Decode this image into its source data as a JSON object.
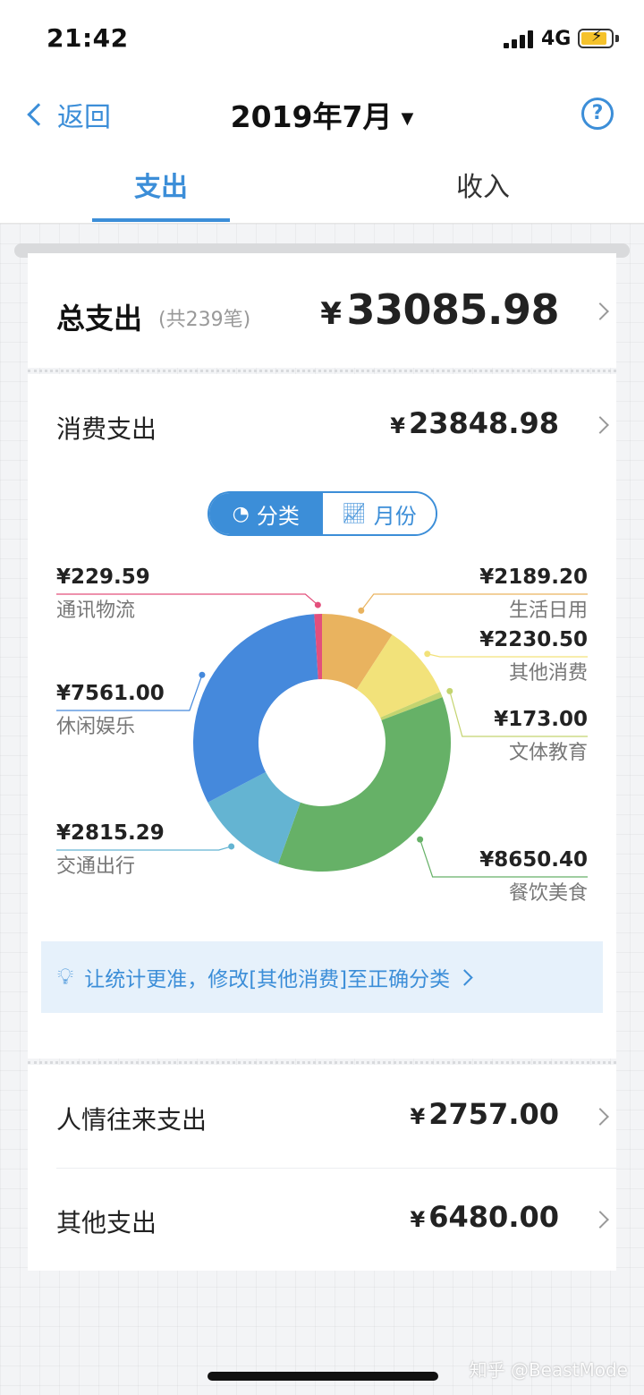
{
  "status_bar": {
    "time": "21:42",
    "network": "4G"
  },
  "nav": {
    "back_label": "返回",
    "title": "2019年7月",
    "title_caret": "▼",
    "help_label": "?"
  },
  "tabs": [
    {
      "label": "支出",
      "active": true
    },
    {
      "label": "收入",
      "active": false
    }
  ],
  "total": {
    "label": "总支出",
    "count": "(共239笔)",
    "currency": "¥",
    "amount": "33085.98"
  },
  "consume": {
    "label": "消费支出",
    "currency": "¥",
    "amount": "23848.98",
    "toggle": {
      "category": "分类",
      "month": "月份"
    }
  },
  "chart_data": {
    "type": "pie",
    "donut": true,
    "categories": [
      "生活日用",
      "其他消费",
      "文体教育",
      "餐饮美食",
      "交通出行",
      "休闲娱乐",
      "通讯物流"
    ],
    "values": [
      2189.2,
      2230.5,
      173.0,
      8650.4,
      2815.29,
      7561.0,
      229.59
    ],
    "colors": [
      "#e9b35f",
      "#f2e27a",
      "#c4d46f",
      "#66b167",
      "#64b4d2",
      "#4589dc",
      "#e34f7c"
    ],
    "labels": [
      {
        "amount": "¥2189.20",
        "name": "生活日用"
      },
      {
        "amount": "¥2230.50",
        "name": "其他消费"
      },
      {
        "amount": "¥173.00",
        "name": "文体教育"
      },
      {
        "amount": "¥8650.40",
        "name": "餐饮美食"
      },
      {
        "amount": "¥2815.29",
        "name": "交通出行"
      },
      {
        "amount": "¥7561.00",
        "name": "休闲娱乐"
      },
      {
        "amount": "¥229.59",
        "name": "通讯物流"
      }
    ]
  },
  "tip": {
    "text": "让统计更准，修改[其他消费]至正确分类"
  },
  "other_rows": [
    {
      "label": "人情往来支出",
      "currency": "¥",
      "amount": "2757.00"
    },
    {
      "label": "其他支出",
      "currency": "¥",
      "amount": "6480.00"
    }
  ],
  "watermark": "知乎 @BeastMode",
  "colors": {
    "accent": "#3c8ed8",
    "tip_bg": "#e6f1fb"
  }
}
